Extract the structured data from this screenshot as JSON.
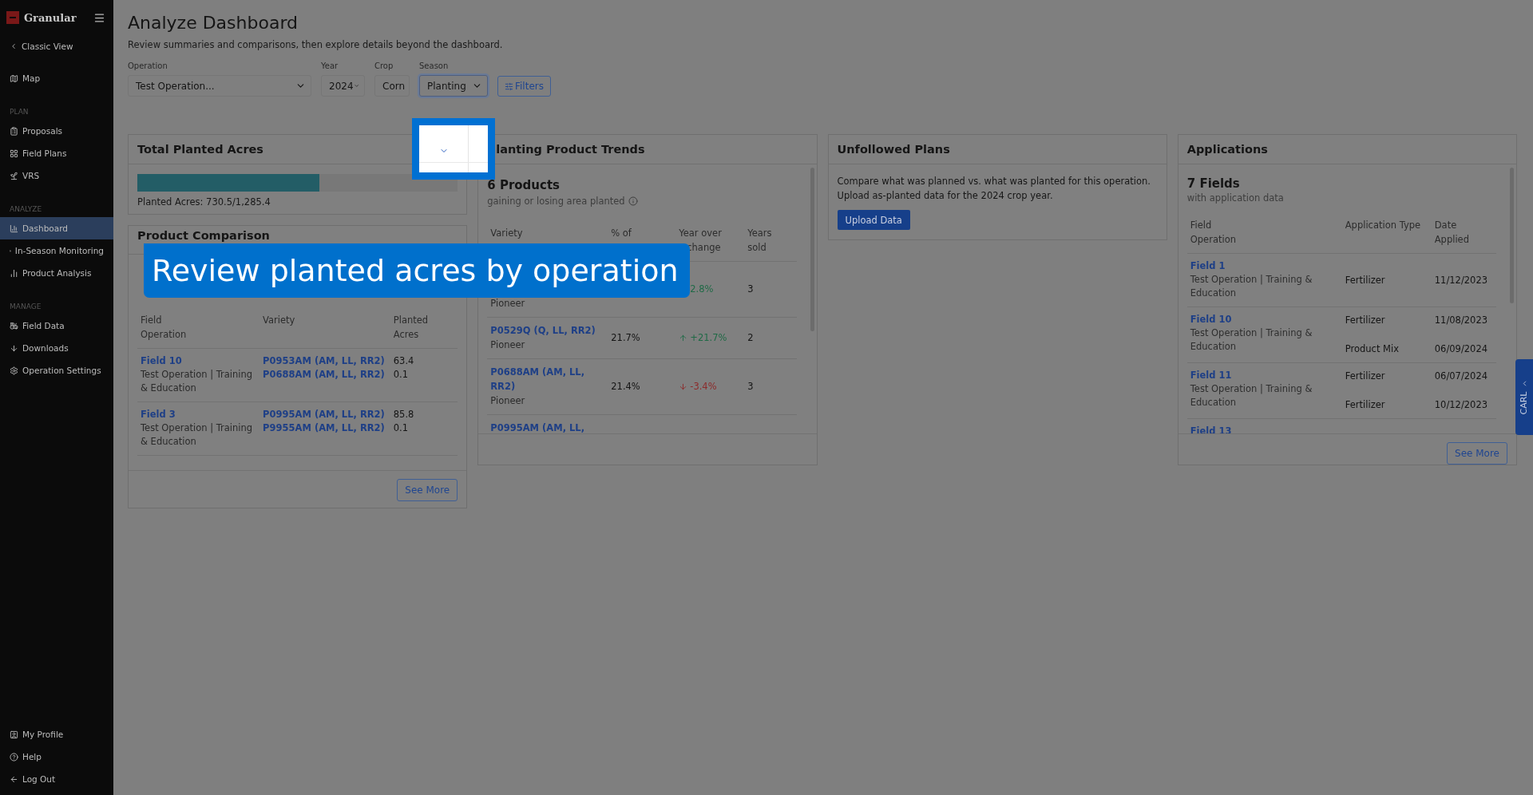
{
  "sidebar": {
    "logo": "Granular",
    "back": "Classic View",
    "sections": [
      {
        "items": [
          {
            "label": "Map",
            "selected": false
          }
        ]
      },
      {
        "label": "PLAN",
        "items": [
          {
            "label": "Proposals",
            "selected": false
          },
          {
            "label": "Field Plans",
            "selected": false
          },
          {
            "label": "VRS",
            "selected": false
          }
        ]
      },
      {
        "label": "ANALYZE",
        "items": [
          {
            "label": "Dashboard",
            "selected": true
          },
          {
            "label": "In-Season Monitoring",
            "selected": false
          },
          {
            "label": "Product Analysis",
            "selected": false
          }
        ]
      },
      {
        "label": "MANAGE",
        "items": [
          {
            "label": "Field Data",
            "selected": false
          },
          {
            "label": "Downloads",
            "selected": false
          },
          {
            "label": "Operation Settings",
            "selected": false
          }
        ]
      }
    ],
    "bottom": [
      {
        "label": "My Profile"
      },
      {
        "label": "Help"
      },
      {
        "label": "Log Out"
      }
    ]
  },
  "page": {
    "title": "Analyze Dashboard",
    "subtitle": "Review summaries and comparisons, then explore details beyond the dashboard."
  },
  "filters": [
    {
      "label": "Operation",
      "value": "Test Operation...",
      "focused": false
    },
    {
      "label": "Year",
      "value": "2024",
      "focused": false
    },
    {
      "label": "Crop",
      "value": "Corn",
      "focused": false
    },
    {
      "label": "Season",
      "value": "Planting",
      "focused": true
    }
  ],
  "filters_button": "Filters",
  "total_planted": {
    "title": "Total Planted Acres",
    "level": 0.568,
    "reading": "Planted Acres: 730.5/1,285.4"
  },
  "product_comparison": {
    "title": "Product Comparison",
    "columns": [
      "Field",
      "Operation",
      "Variety",
      "Planted",
      "Acres"
    ],
    "rows": [
      {
        "field": "Field 10",
        "operation": "Test Operation | Training & Education",
        "varieties": [
          {
            "name": "P0953AM (AM, LL, RR2)",
            "acres": "63.4"
          },
          {
            "name": "P0688AM (AM, LL, RR2)",
            "acres": "0.1"
          }
        ]
      },
      {
        "field": "Field 3",
        "operation": "Test Operation | Training & Education",
        "varieties": [
          {
            "name": "P0995AM (AM, LL, RR2)",
            "acres": "85.8"
          },
          {
            "name": "P9955AM (AM, LL, RR2)",
            "acres": "0.1"
          }
        ]
      }
    ],
    "button": "See More"
  },
  "trends": {
    "title": "lanting Product Trends",
    "count": "6 Products",
    "subtitle": "gaining or losing area planted",
    "columns": [
      "Variety",
      "% of",
      "Year over",
      "change",
      "Years",
      "sold"
    ],
    "rows": [
      {
        "brand": "Pioneer",
        "change": "2.8%",
        "rising": true,
        "arrow": false,
        "years": "3"
      },
      {
        "variety": "P0529Q (Q, LL, RR2)",
        "brand": "Pioneer",
        "share": "21.7%",
        "change": "+21.7%",
        "rising": true,
        "arrow": true,
        "years": "2"
      },
      {
        "variety": "P0688AM (AM, LL, RR2)",
        "brand": "Pioneer",
        "share": "21.4%",
        "change": "-3.4%",
        "rising": false,
        "arrow": true,
        "years": "3"
      },
      {
        "variety": "P0995AM (AM, LL,"
      }
    ]
  },
  "unfollowed": {
    "title": "Unfollowed Plans",
    "text": "Compare what was planned vs. what was planted for this operation. Upload as-planted data for the 2024 crop year.",
    "button": "Upload Data"
  },
  "applications": {
    "title": "Applications",
    "count": "7 Fields",
    "subtitle": "with application data",
    "columns": [
      "Field",
      "Operation",
      "Application Type",
      "Date Applied"
    ],
    "rows": [
      {
        "field": "Field 1",
        "operation": "Test Operation | Training & Education",
        "entries": [
          {
            "type": "Fertilizer",
            "date": "11/12/2023"
          }
        ]
      },
      {
        "field": "Field 10",
        "operation": "Test Operation | Training & Education",
        "entries": [
          {
            "type": "Fertilizer",
            "date": "11/08/2023"
          },
          {
            "type": "Product Mix",
            "date": "06/09/2024"
          }
        ]
      },
      {
        "field": "Field 11",
        "operation": "Test Operation | Training & Education",
        "entries": [
          {
            "type": "Fertilizer",
            "date": "06/07/2024"
          },
          {
            "type": "Fertilizer",
            "date": "10/12/2023"
          }
        ]
      },
      {
        "field": "Field 13"
      }
    ],
    "button": "See More"
  },
  "side_tab": "CARL",
  "callout": "Review planted acres by operation"
}
